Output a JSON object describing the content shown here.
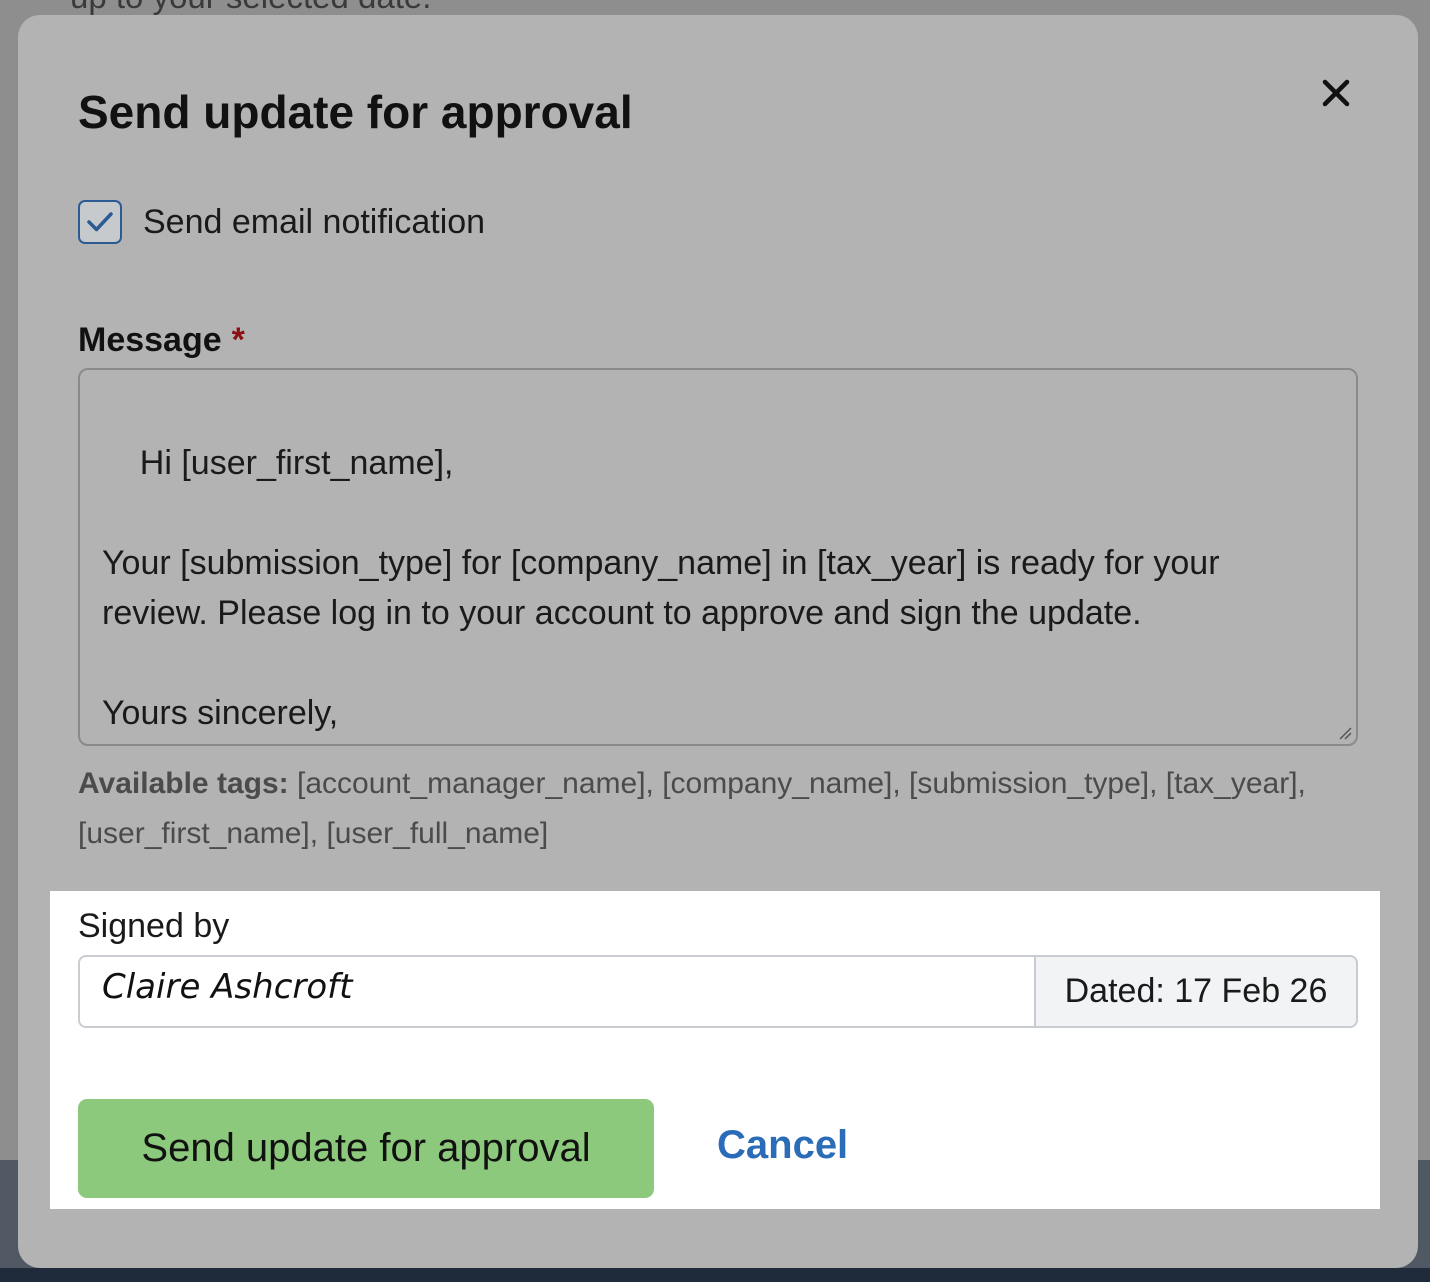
{
  "background": {
    "partial_text": "up to your selected date."
  },
  "modal": {
    "title": "Send update for approval",
    "close_icon": "close-icon",
    "email_notification": {
      "label": "Send email notification",
      "checked": true
    },
    "message": {
      "label": "Message",
      "required_marker": "*",
      "value": "Hi [user_first_name],\n\nYour [submission_type] for [company_name] in [tax_year] is ready for your review. Please log in to your account to approve and sign the update.\n\nYours sincerely,\n[account_manager_name]"
    },
    "available_tags": {
      "label": "Available tags:",
      "list": "[account_manager_name], [company_name], [submission_type], [tax_year], [user_first_name], [user_full_name]"
    },
    "signature": {
      "label": "Signed by",
      "value": "Claire Ashcroft",
      "dated": "Dated: 17 Feb 26"
    },
    "actions": {
      "submit_label": "Send update for approval",
      "cancel_label": "Cancel"
    }
  },
  "colors": {
    "overlay": "#8e8e8e",
    "modal_bg": "#b3b3b3",
    "primary_button": "#8cc97c",
    "link": "#2b6cb8",
    "required": "#8b1010",
    "checkbox_border": "#2c5b94"
  }
}
